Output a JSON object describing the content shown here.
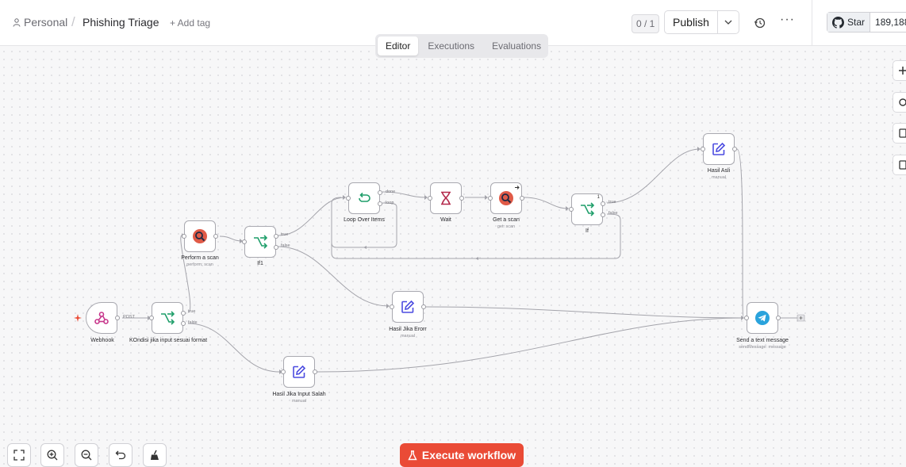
{
  "header": {
    "breadcrumb_personal": "Personal",
    "workflow_title": "Phishing Triage",
    "add_tag": "+ Add tag",
    "version_counter": "0 / 1",
    "publish_label": "Publish",
    "more_label": "···",
    "github_star_label": "Star",
    "github_star_count": "189,188"
  },
  "tabs": [
    {
      "label": "Editor",
      "active": true
    },
    {
      "label": "Executions",
      "active": false
    },
    {
      "label": "Evaluations",
      "active": false
    }
  ],
  "nodes": {
    "webhook": {
      "label": "Webhook",
      "port": "POST"
    },
    "kondisi": {
      "label": "KOndisi jika input sesuai format",
      "true": "true",
      "false": "false"
    },
    "perform_scan": {
      "label": "Perform a scan",
      "sub": "perform: scan"
    },
    "if1": {
      "label": "If1",
      "true": "true",
      "false": "false"
    },
    "loop": {
      "label": "Loop Over Items",
      "done": "done",
      "loop": "loop"
    },
    "wait": {
      "label": "Wait"
    },
    "get_scan": {
      "label": "Get a scan",
      "sub": "get: scan"
    },
    "if": {
      "label": "If",
      "badge": "1",
      "true": "true",
      "false": "false"
    },
    "hasil_asli": {
      "label": "Hasil Asli",
      "sub": "manual"
    },
    "hasil_error": {
      "label": "Hasil Jika Erorr",
      "sub": "manual"
    },
    "hasil_salah": {
      "label": "Hasil Jika Input Salah",
      "sub": "manual"
    },
    "telegram": {
      "label": "Send a text message",
      "sub": "sendMessage: message"
    }
  },
  "footer": {
    "execute_label": "Execute workflow"
  },
  "colors": {
    "accent": "#ea4b36",
    "if_green": "#1f9e6a",
    "edit_purple": "#4c4ce0",
    "telegram_blue": "#2aa3dc",
    "webhook_pink": "#c7368b",
    "wait_red": "#b3294b"
  }
}
